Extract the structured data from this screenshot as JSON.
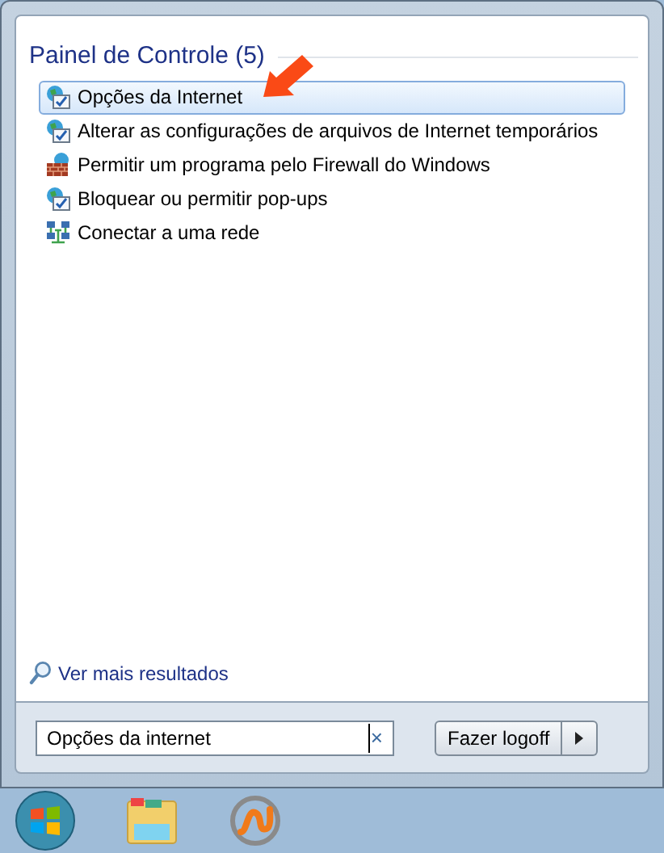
{
  "results": {
    "heading": "Painel de Controle (5)",
    "items": [
      {
        "kind": "internet",
        "label": "Opções da Internet",
        "selected": true
      },
      {
        "kind": "internet",
        "label": "Alterar as configurações de arquivos de Internet temporários",
        "selected": false
      },
      {
        "kind": "firewall",
        "label": "Permitir um programa pelo Firewall do Windows",
        "selected": false
      },
      {
        "kind": "internet",
        "label": "Bloquear ou permitir pop-ups",
        "selected": false
      },
      {
        "kind": "network",
        "label": "Conectar a uma rede",
        "selected": false
      }
    ]
  },
  "more_results": "Ver mais resultados",
  "search": {
    "value": "Opções da internet",
    "clear": "×"
  },
  "logoff_button": "Fazer logoff"
}
